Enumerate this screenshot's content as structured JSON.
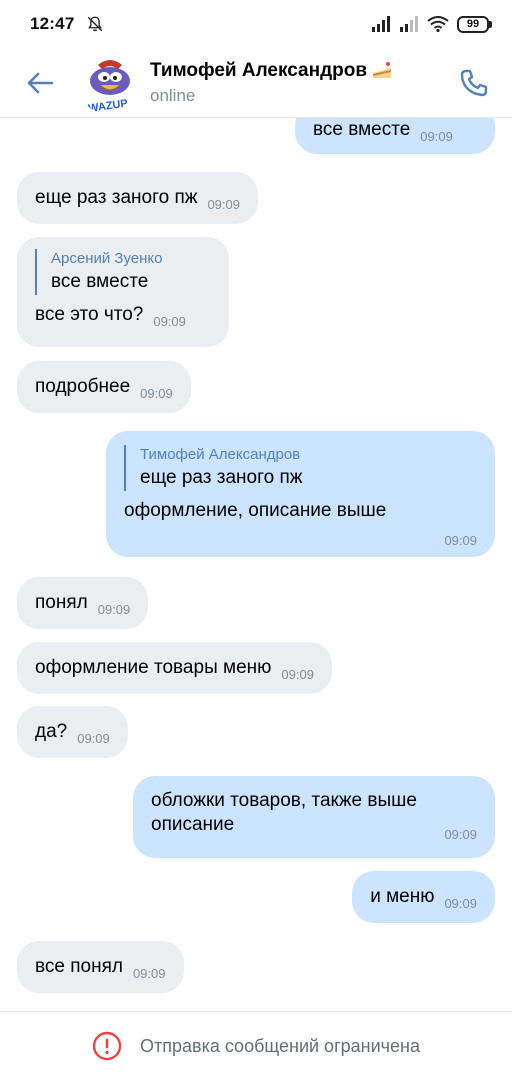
{
  "status_bar": {
    "time": "12:47",
    "battery": "99"
  },
  "header": {
    "contact_name": "Тимофей Александров",
    "contact_status": "online"
  },
  "messages": [
    {
      "direction": "out",
      "text": "все вместе",
      "time": "09:09"
    },
    {
      "direction": "in",
      "text": "еще раз заного пж",
      "time": "09:09"
    },
    {
      "direction": "in",
      "reply_author": "Арсений Зуенко",
      "reply_text": "все вместе",
      "text": "все это что?",
      "time": "09:09"
    },
    {
      "direction": "in",
      "text": "подробнее",
      "time": "09:09"
    },
    {
      "direction": "out",
      "reply_author": "Тимофей Александров",
      "reply_text": "еще раз заного пж",
      "text": "оформление, описание выше",
      "time": "09:09"
    },
    {
      "direction": "in",
      "text": "понял",
      "time": "09:09"
    },
    {
      "direction": "in",
      "text": "оформление товары меню",
      "time": "09:09"
    },
    {
      "direction": "in",
      "text": "да?",
      "time": "09:09"
    },
    {
      "direction": "out",
      "text": "обложки товаров, также выше описание",
      "time": "09:09"
    },
    {
      "direction": "out",
      "text": "и меню",
      "time": "09:09"
    },
    {
      "direction": "in",
      "text": "все понял",
      "time": "09:09"
    }
  ],
  "footer": {
    "notice": "Отправка сообщений ограничена"
  },
  "colors": {
    "accent": "#5181b8",
    "bubble_in": "#ebedf0",
    "bubble_out": "#cce4ff",
    "warning": "#e64646"
  }
}
